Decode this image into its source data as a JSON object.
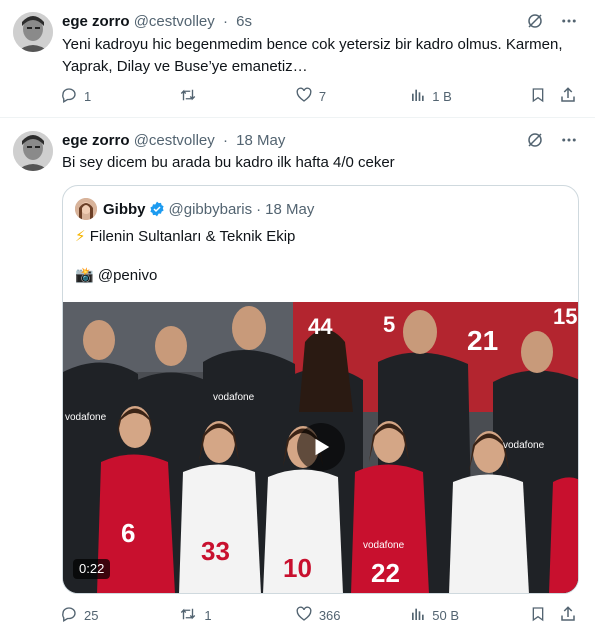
{
  "tweets": [
    {
      "display_name": "ege zorro",
      "handle": "@cestvolley",
      "separator": "·",
      "time": "6s",
      "text_line1": "Yeni kadroyu hic begenmedim bence cok yetersiz bir kadro olmus. Karmen,",
      "text_line2": "Yaprak, Dilay ve Buse’ye emanetiz…",
      "replies": "1",
      "retweets": "",
      "likes": "7",
      "views": "1 B"
    },
    {
      "display_name": "ege zorro",
      "handle": "@cestvolley",
      "separator": "·",
      "time": "18 May",
      "text_line1": "Bi sey dicem bu arada bu kadro ilk hafta 4/0 ceker",
      "replies": "25",
      "retweets": "1",
      "likes": "366",
      "views": "50 B"
    }
  ],
  "quote": {
    "display_name": "Gibby",
    "handle": "@gibbybaris",
    "separator": "·",
    "time": "18 May",
    "line1_emoji": "⚡",
    "line1": "Filenin Sultanları & Teknik Ekip",
    "line2_emoji": "📸",
    "line2": "@penivo",
    "video_duration": "0:22",
    "jersey_numbers": [
      "44",
      "5",
      "21",
      "15",
      "6",
      "33",
      "10",
      "22"
    ],
    "sponsor": "vodafone"
  },
  "colors": {
    "text": "#0f1419",
    "secondary": "#536471",
    "border": "#cfd9de",
    "verified": "#1d9bf0",
    "jersey_red": "#c8102e"
  },
  "icons": [
    "grok-icon",
    "more-icon",
    "reply-icon",
    "retweet-icon",
    "like-icon",
    "views-icon",
    "bookmark-icon",
    "share-icon",
    "verified-icon",
    "play-icon"
  ]
}
